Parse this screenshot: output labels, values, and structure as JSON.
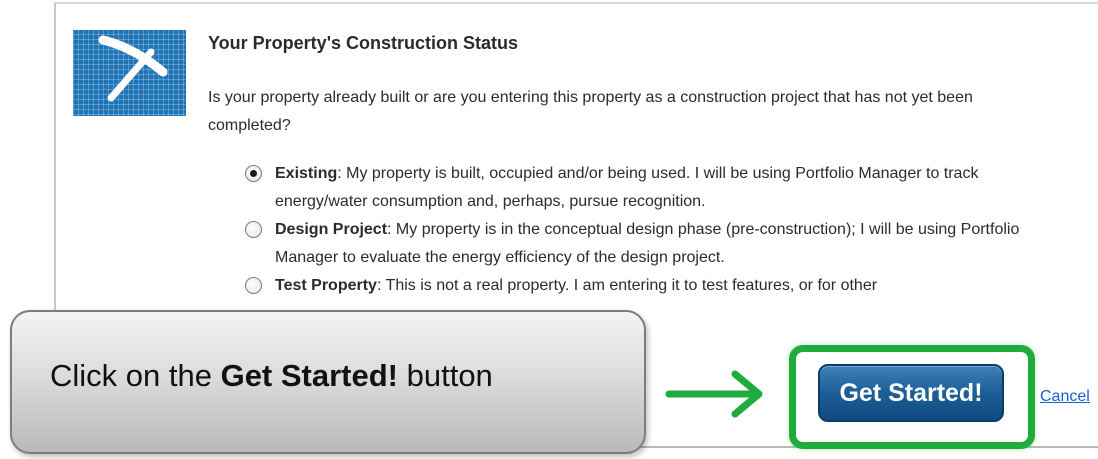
{
  "dialog": {
    "title": "Your Property's Construction Status",
    "question": "Is your property already built or are you entering this property as a construction project that has not yet been completed?",
    "options": [
      {
        "label": "Existing",
        "text": ": My property is built, occupied and/or being used. I will be using Portfolio Manager to track energy/water consumption and, perhaps, pursue recognition.",
        "selected": true
      },
      {
        "label": "Design Project",
        "text": ": My property is in the conceptual design phase (pre-construction); I will be using Portfolio Manager to evaluate the energy efficiency of the design project.",
        "selected": false
      },
      {
        "label": "Test Property",
        "text": ": This is not a real property. I am entering it to test features, or for other",
        "selected": false
      }
    ],
    "get_started_label": "Get Started!",
    "cancel_label": "Cancel"
  },
  "callout": {
    "prefix": "Click on the ",
    "emphasis": "Get Started!",
    "suffix": " button"
  },
  "icons": {
    "logo": "construction-pick-icon",
    "arrow": "right-arrow-icon"
  },
  "colors": {
    "button": "#1d5e98",
    "highlight": "#1fab3d",
    "arrow": "#1fab3d",
    "logo_bg": "#1e74b4",
    "link": "#1a5fd0"
  }
}
